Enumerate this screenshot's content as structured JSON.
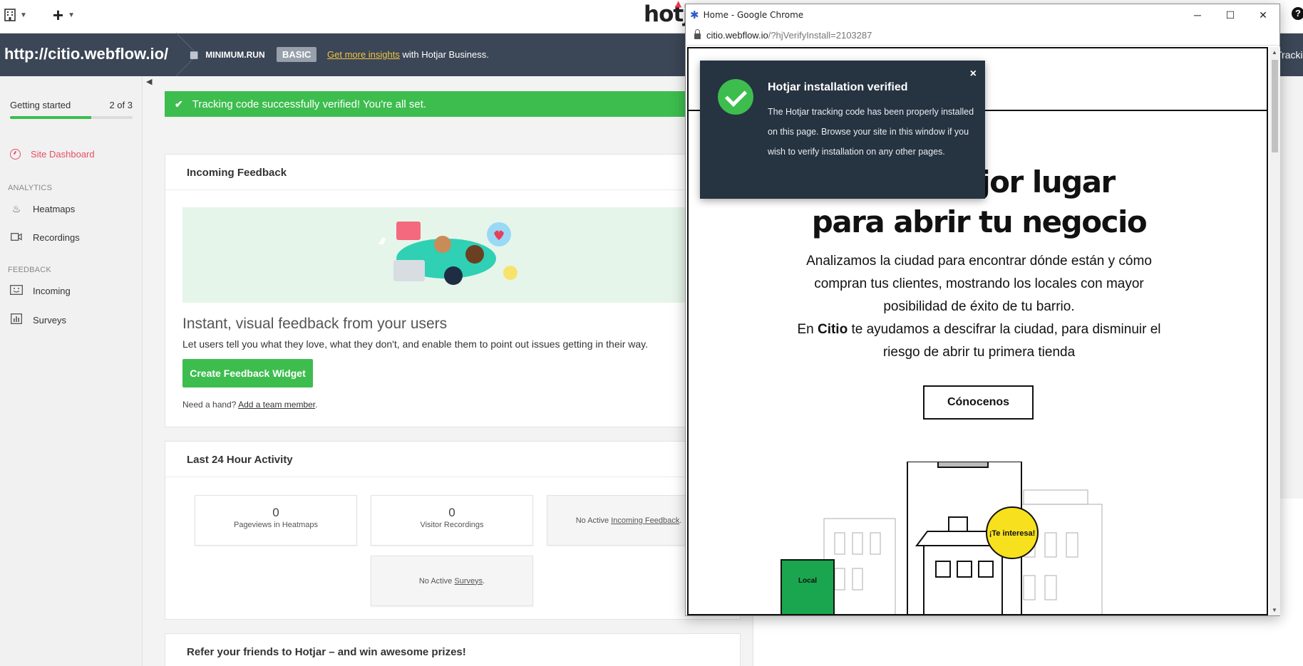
{
  "topbar": {
    "logo": "hotjar",
    "org_icon": "building-icon",
    "help": "?"
  },
  "sitebar": {
    "site_url": "http://citio.webflow.io/",
    "org_name": "MINIMUM.RUN",
    "plan": "BASIC",
    "upsell_link": "Get more insights",
    "upsell_text": " with Hotjar Business.",
    "tracking_label": "Tracki"
  },
  "sidebar": {
    "getting_started": {
      "label": "Getting started",
      "count": "2 of 3",
      "progress": 0.66
    },
    "dashboard": "Site Dashboard",
    "analytics_heading": "ANALYTICS",
    "heatmaps": "Heatmaps",
    "recordings": "Recordings",
    "feedback_heading": "FEEDBACK",
    "incoming": "Incoming",
    "surveys": "Surveys"
  },
  "alert": {
    "text": "Tracking code successfully verified! You're all set."
  },
  "incoming_feedback": {
    "title": "Incoming Feedback",
    "headline": "Instant, visual feedback from your users",
    "description": "Let users tell you what they love, what they don't, and enable them to point out issues getting in their way.",
    "button": "Create Feedback Widget",
    "help_prefix": "Need a hand? ",
    "help_link": "Add a team member",
    "help_suffix": "."
  },
  "activity": {
    "title": "Last 24 Hour Activity",
    "pageviews": {
      "value": "0",
      "label": "Pageviews in Heatmaps"
    },
    "recordings": {
      "value": "0",
      "label": "Visitor Recordings"
    },
    "incoming_prefix": "No Active ",
    "incoming_link": "Incoming Feedback",
    "incoming_suffix": ".",
    "surveys_prefix": "No Active ",
    "surveys_link": "Surveys",
    "surveys_suffix": "."
  },
  "refer": {
    "title": "Refer your friends to Hotjar – and win awesome prizes!"
  },
  "chrome": {
    "window_title": "Home - Google Chrome",
    "address_host": "citio.webflow.io",
    "address_path": "/?hjVerifyInstall=2103287"
  },
  "toast": {
    "title": "Hotjar installation verified",
    "body": "The Hotjar tracking code has been properly installed on this page. Browse your site in this window if you wish to verify installation on any other pages.",
    "close": "×"
  },
  "website": {
    "title_line1": "mejor lugar",
    "title_line2": "para abrir tu negocio",
    "body_p1": "Analizamos la ciudad para encontrar dónde están y cómo compran tus clientes, mostrando los locales con mayor posibilidad de éxito de tu barrio.",
    "body_p2_prefix": "En ",
    "body_p2_brand": "Citio",
    "body_p2_rest": " te ayudamos a descifrar la ciudad, para disminuir el riesgo de abrir tu primera tienda",
    "cta": "Cónocenos",
    "badge": "¡Te interesa!",
    "local_label": "Local"
  },
  "colors": {
    "brand_green": "#3dbd4e",
    "dark_bar": "#3b4656",
    "toast_bg": "#263341",
    "accent_red": "#e55066",
    "badge_yellow": "#f7e01e"
  }
}
